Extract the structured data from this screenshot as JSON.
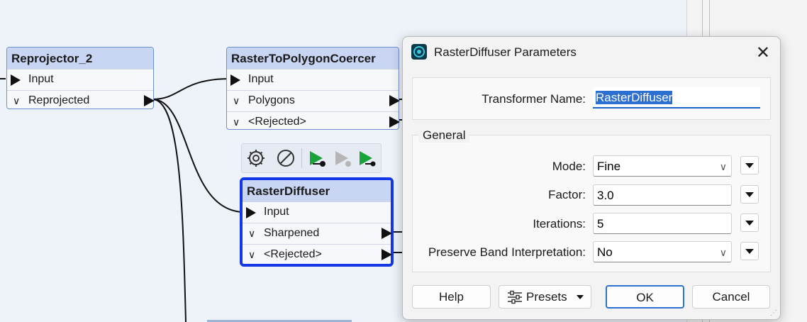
{
  "canvas": {
    "nodes": [
      {
        "title": "Reprojector_2",
        "ports": [
          "Input",
          "Reprojected"
        ]
      },
      {
        "title": "RasterToPolygonCoercer",
        "ports": [
          "Input",
          "Polygons",
          "<Rejected>"
        ]
      },
      {
        "title": "RasterDiffuser",
        "ports": [
          "Input",
          "Sharpened",
          "<Rejected>"
        ]
      }
    ],
    "toolbar": [
      "gear-icon",
      "disable-icon",
      "run-to-this-icon",
      "run-from-this-icon",
      "run-this-icon"
    ]
  },
  "dialog": {
    "title": "RasterDiffuser Parameters",
    "transformer_name_label": "Transformer Name:",
    "transformer_name_value": "RasterDiffuser",
    "group_label": "General",
    "fields": [
      {
        "label": "Mode:",
        "value": "Fine",
        "kind": "dropdown"
      },
      {
        "label": "Factor:",
        "value": "3.0",
        "kind": "text"
      },
      {
        "label": "Iterations:",
        "value": "5",
        "kind": "text"
      },
      {
        "label": "Preserve Band Interpretation:",
        "value": "No",
        "kind": "dropdown"
      }
    ],
    "buttons": {
      "help": "Help",
      "presets": "Presets",
      "ok": "OK",
      "cancel": "Cancel"
    }
  }
}
